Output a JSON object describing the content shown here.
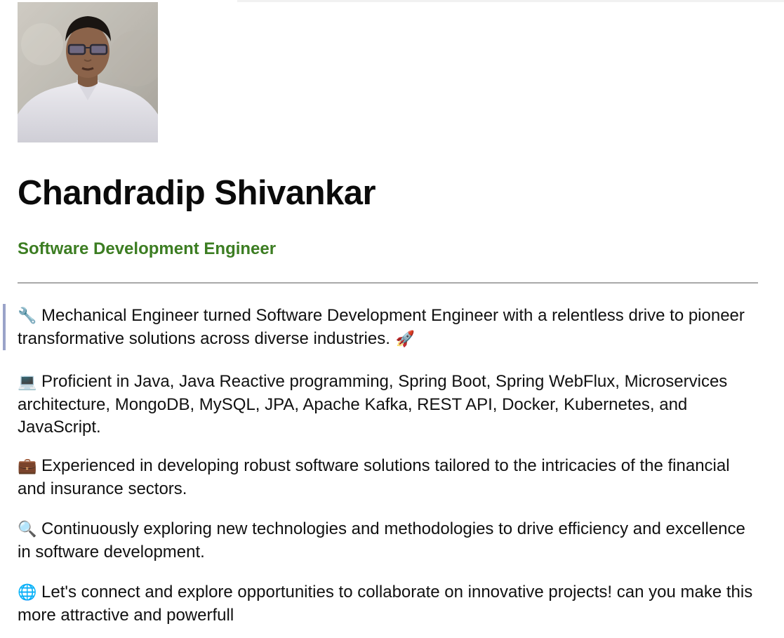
{
  "profile": {
    "photo_alt": "Chandradip Shivankar",
    "name": "Chandradip Shivankar",
    "title": "Software Development Engineer"
  },
  "colors": {
    "title_green": "#3c7d22",
    "quote_bar": "#9aa3c9",
    "rule": "#a9a9a9"
  },
  "about": [
    {
      "icon": "wrench-icon",
      "glyph": "🔧",
      "text": "Mechanical Engineer turned Software Development Engineer with a relentless drive to pioneer transformative solutions across diverse industries.",
      "tail_icon": "rocket-icon",
      "tail_glyph": "🚀"
    },
    {
      "icon": "laptop-icon",
      "glyph": "💻",
      "text": "Proficient in Java, Java Reactive programming, Spring Boot, Spring WebFlux, Microservices architecture, MongoDB, MySQL, JPA, Apache Kafka, REST API, Docker, Kubernetes, and JavaScript."
    },
    {
      "icon": "briefcase-icon",
      "glyph": "💼",
      "text": "Experienced in developing robust software solutions tailored to the intricacies of the financial and insurance sectors."
    },
    {
      "icon": "magnifier-icon",
      "glyph": "🔍",
      "text": "Continuously exploring new technologies and methodologies to drive efficiency and excellence in software development."
    },
    {
      "icon": "globe-icon",
      "glyph": "🌐",
      "text": "Let's connect and explore opportunities to collaborate on innovative projects! can you make this more attractive and powerfull"
    }
  ]
}
